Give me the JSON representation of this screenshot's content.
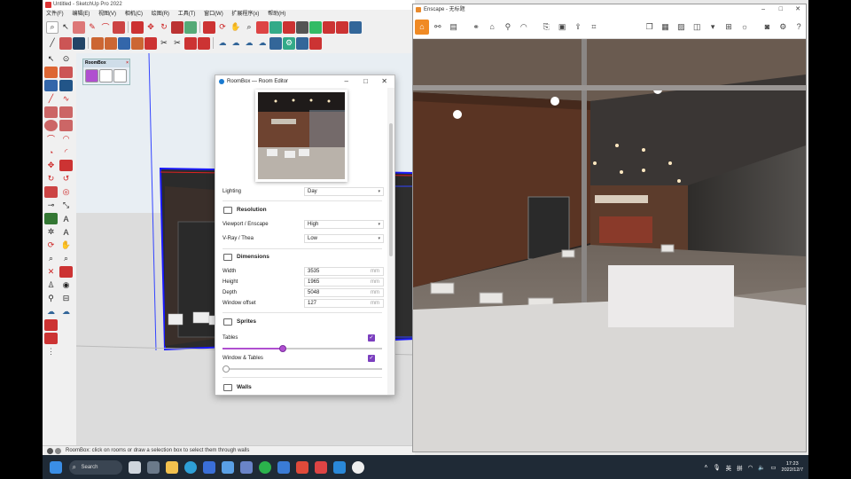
{
  "sketchup": {
    "title": "Untitled - SketchUp Pro 2022",
    "menu": [
      "文件(F)",
      "编辑(E)",
      "视图(V)",
      "相机(C)",
      "绘图(R)",
      "工具(T)",
      "窗口(W)",
      "扩展程序(x)",
      "帮助(H)"
    ],
    "status_text": "RoomBox: click on rooms or draw a selection box to select them through walls"
  },
  "roombox_toolbar": {
    "title": "RoomBox",
    "close": "×"
  },
  "dialog": {
    "title": "RoomBox — Room Editor",
    "lighting": {
      "label": "Lighting",
      "value": "Day"
    },
    "resolution": {
      "header": "Resolution",
      "viewport": {
        "label": "Viewport / Enscape",
        "value": "High"
      },
      "vray": {
        "label": "V-Ray / Thea",
        "value": "Low"
      }
    },
    "dimensions": {
      "header": "Dimensions",
      "unit": "mm",
      "width": {
        "label": "Width",
        "value": "3535"
      },
      "height": {
        "label": "Height",
        "value": "1965"
      },
      "depth": {
        "label": "Depth",
        "value": "5048"
      },
      "window_offset": {
        "label": "Window offset",
        "value": "127"
      }
    },
    "sprites": {
      "header": "Sprites",
      "tables": {
        "label": "Tables",
        "checked": true,
        "slider": 0.38
      },
      "window_tables": {
        "label": "Window & Tables",
        "checked": true,
        "slider": 0.0
      }
    },
    "walls": {
      "header": "Walls"
    }
  },
  "enscape": {
    "title": "Enscape - 无标题"
  },
  "taskbar": {
    "search": "Search",
    "lang": "英",
    "ime": "拼",
    "time": "17:23",
    "date": "2022/12/7"
  },
  "colors": {
    "accent_purple": "#7b3fbf",
    "enscape_orange": "#f08a24",
    "taskbar": "#1f2a36"
  }
}
